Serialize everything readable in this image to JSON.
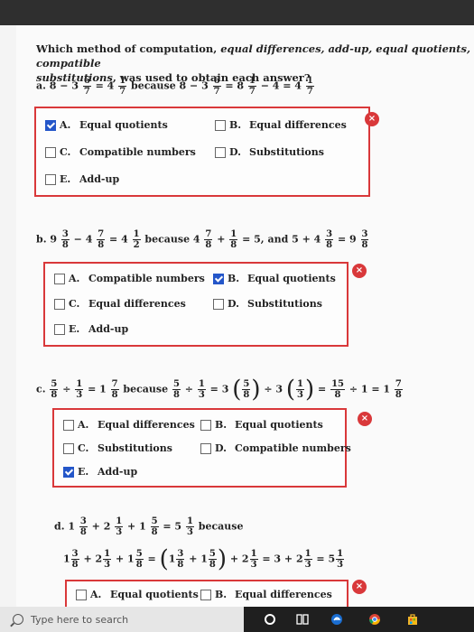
{
  "question": {
    "lead": "Which method of computation, ",
    "methods": "equal differences, add-up, equal quotients, compatible",
    "line2": "substitutions",
    "tail": ", was used to obtain each answer?"
  },
  "problems": {
    "a": {
      "label": "a. 8 − 3",
      "f1": {
        "n": "6",
        "d": "7"
      },
      "eq1": "= 4",
      "f2": {
        "n": "1",
        "d": "7"
      },
      "because": "because 8 − 3",
      "f3": {
        "n": "6",
        "d": "7"
      },
      "eq2": "= 8",
      "f4": {
        "n": "1",
        "d": "7"
      },
      "eq3": "− 4 = 4",
      "f5": {
        "n": "1",
        "d": "7"
      }
    },
    "b": {
      "label": "b. 9",
      "f1": {
        "n": "3",
        "d": "8"
      },
      "minus": "− 4",
      "f2": {
        "n": "7",
        "d": "8"
      },
      "eq1": "= 4",
      "f3": {
        "n": "1",
        "d": "2"
      },
      "because": "because 4",
      "f4": {
        "n": "7",
        "d": "8"
      },
      "plus": "+",
      "f5": {
        "n": "1",
        "d": "8"
      },
      "eq2": "= 5, and 5 + 4",
      "f6": {
        "n": "3",
        "d": "8"
      },
      "eq3": "= 9",
      "f7": {
        "n": "3",
        "d": "8"
      }
    },
    "c": {
      "label": "c.",
      "f1": {
        "n": "5",
        "d": "8"
      },
      "div": "÷",
      "f2": {
        "n": "1",
        "d": "3"
      },
      "eq1": "= 1",
      "f3": {
        "n": "7",
        "d": "8"
      },
      "because": "because",
      "f4": {
        "n": "5",
        "d": "8"
      },
      "div2": "÷",
      "f5": {
        "n": "1",
        "d": "3"
      },
      "eq2": "= 3",
      "f6": {
        "n": "5",
        "d": "8"
      },
      "div3": "÷ 3",
      "f7": {
        "n": "1",
        "d": "3"
      },
      "eq3": "=",
      "f8": {
        "n": "15",
        "d": "8"
      },
      "eq4": "÷ 1 = 1",
      "f9": {
        "n": "7",
        "d": "8"
      }
    },
    "d": {
      "label": "d. 1",
      "f1": {
        "n": "3",
        "d": "8"
      },
      "p1": "+ 2",
      "f2": {
        "n": "1",
        "d": "3"
      },
      "p2": "+ 1",
      "f3": {
        "n": "5",
        "d": "8"
      },
      "eq1": "= 5",
      "f4": {
        "n": "1",
        "d": "3"
      },
      "because": "because",
      "l2a": "1",
      "g1": {
        "n": "3",
        "d": "8"
      },
      "l2b": "+ 2",
      "g2": {
        "n": "1",
        "d": "3"
      },
      "l2c": "+ 1",
      "g3": {
        "n": "5",
        "d": "8"
      },
      "l2d": "=",
      "l2e": "1",
      "g4": {
        "n": "3",
        "d": "8"
      },
      "l2f": "+ 1",
      "g5": {
        "n": "5",
        "d": "8"
      },
      "l2g": "+ 2",
      "g6": {
        "n": "1",
        "d": "3"
      },
      "l2h": "= 3 + 2",
      "g7": {
        "n": "1",
        "d": "3"
      },
      "l2i": "= 5",
      "g8": {
        "n": "1",
        "d": "3"
      }
    }
  },
  "choices": {
    "a": [
      {
        "letter": "A.",
        "label": "Equal quotients",
        "checked": true
      },
      {
        "letter": "B.",
        "label": "Equal differences",
        "checked": false
      },
      {
        "letter": "C.",
        "label": "Compatible numbers",
        "checked": false
      },
      {
        "letter": "D.",
        "label": "Substitutions",
        "checked": false
      },
      {
        "letter": "E.",
        "label": "Add-up",
        "checked": false
      }
    ],
    "b": [
      {
        "letter": "A.",
        "label": "Compatible numbers",
        "checked": false
      },
      {
        "letter": "B.",
        "label": "Equal quotients",
        "checked": true
      },
      {
        "letter": "C.",
        "label": "Equal differences",
        "checked": false
      },
      {
        "letter": "D.",
        "label": "Substitutions",
        "checked": false
      },
      {
        "letter": "E.",
        "label": "Add-up",
        "checked": false
      }
    ],
    "c": [
      {
        "letter": "A.",
        "label": "Equal differences",
        "checked": false
      },
      {
        "letter": "B.",
        "label": "Equal quotients",
        "checked": false
      },
      {
        "letter": "C.",
        "label": "Substitutions",
        "checked": false
      },
      {
        "letter": "D.",
        "label": "Compatible numbers",
        "checked": false
      },
      {
        "letter": "E.",
        "label": "Add-up",
        "checked": true
      }
    ],
    "d": [
      {
        "letter": "A.",
        "label": "Equal quotients",
        "checked": false
      },
      {
        "letter": "B.",
        "label": "Equal differences",
        "checked": false
      }
    ]
  },
  "incorrect_mark": "×",
  "taskbar": {
    "search_placeholder": "Type here to search",
    "icons": [
      "search-icon",
      "cortana-icon",
      "task-view-icon",
      "edge-icon",
      "chrome-icon",
      "store-icon"
    ]
  },
  "colors": {
    "incorrect": "#d9383a",
    "checked": "#2456c9"
  }
}
